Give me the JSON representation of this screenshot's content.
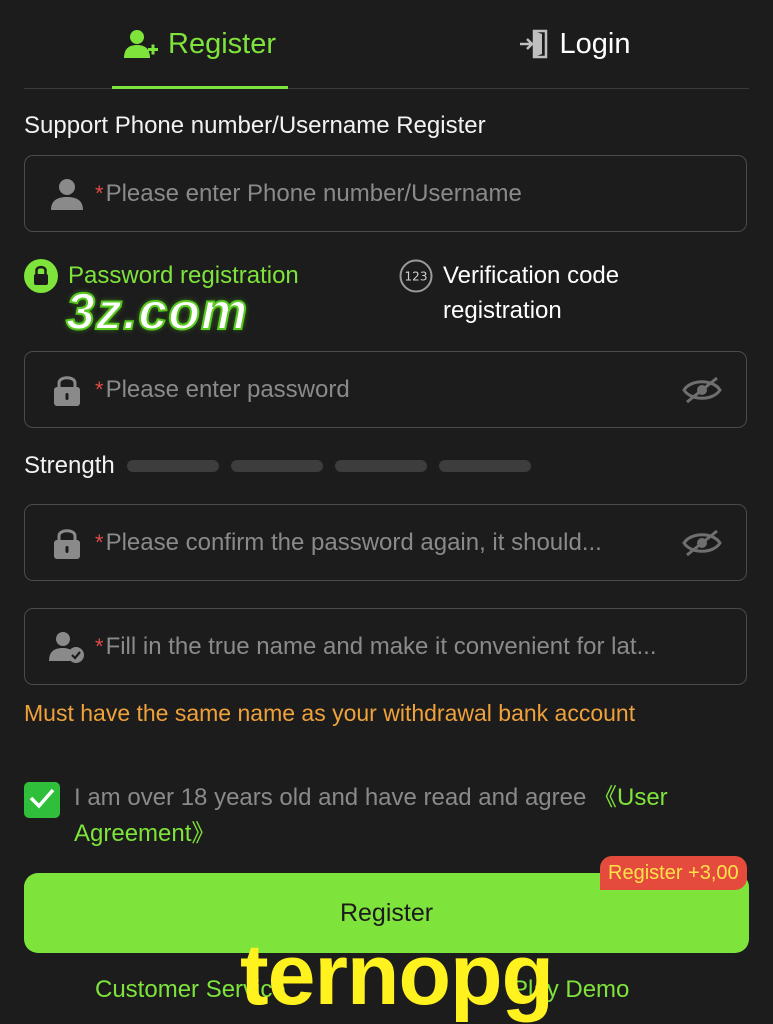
{
  "tabs": {
    "register": "Register",
    "login": "Login"
  },
  "section_title": "Support Phone number/Username Register",
  "fields": {
    "username_placeholder": "Please enter Phone number/Username",
    "password_placeholder": "Please enter password",
    "confirm_placeholder": "Please confirm the password again, it should...",
    "realname_placeholder": "Fill in the true name and make it convenient for lat...",
    "required_mark": "*"
  },
  "modes": {
    "password": "Password registration",
    "code": "Verification code registration",
    "code_icon_text": "123"
  },
  "strength": {
    "label": "Strength",
    "level": 0,
    "segments": 4
  },
  "warning": "Must have the same name as your withdrawal bank account",
  "agreement": {
    "checked": true,
    "text": "I am over 18 years old and have read and agree ",
    "link": "《User Agreement》"
  },
  "register_button": "Register",
  "bonus_badge": "Register +3,00",
  "footer": {
    "customer_service": "Customer Service",
    "play_demo": "Play Demo"
  },
  "watermarks": {
    "brand": "3z.com",
    "site": "ternopg"
  },
  "colors": {
    "accent": "#7ee33a",
    "background": "#1c1c1c",
    "warning": "#f0a23a",
    "badge": "#e54b3c",
    "badge_text": "#ffe14a"
  },
  "icons": {
    "register_tab": "add-user-icon",
    "login_tab": "login-icon",
    "username": "user-icon",
    "password": "lock-icon",
    "visibility": "eye-off-icon",
    "realname": "user-check-icon",
    "mode_password": "lock-circle-icon",
    "mode_code": "numeric-code-icon",
    "checkbox": "check-icon"
  }
}
